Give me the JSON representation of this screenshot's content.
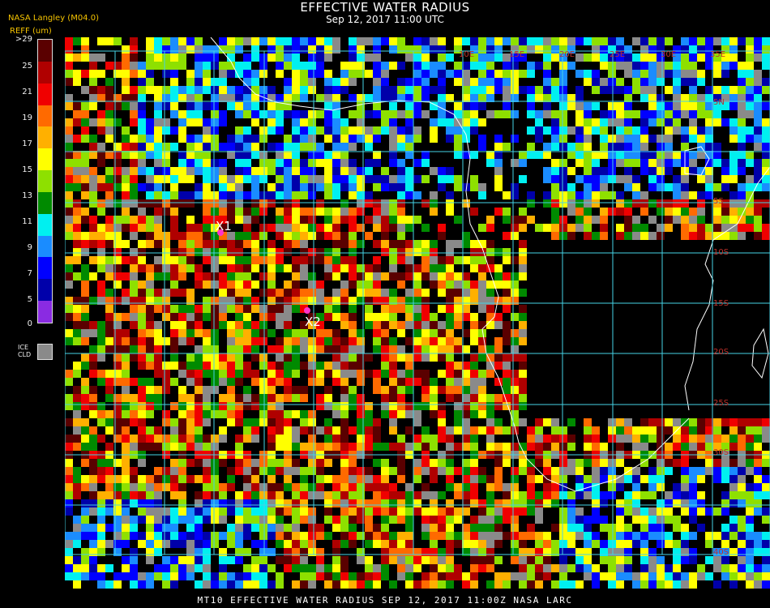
{
  "title": "EFFECTIVE WATER RADIUS",
  "subtitle": "Sep 12, 2017 11:00 UTC",
  "producer": "NASA Langley (M04.0)",
  "units_label": "REFF (um)",
  "colorbar": {
    "labels": [
      ">29",
      "25",
      "21",
      "19",
      "17",
      "15",
      "13",
      "11",
      "9",
      "7",
      "5",
      "0"
    ],
    "colors": [
      "#5a0000",
      "#b00000",
      "#f00000",
      "#ff6a00",
      "#ffb000",
      "#ffff00",
      "#8ee000",
      "#008a00",
      "#00f0f0",
      "#1a8cff",
      "#0000ff",
      "#0000aa",
      "#8a2be2"
    ]
  },
  "ice_cloud_label_line1": "ICE",
  "ice_cloud_label_line2": "CLD",
  "ice_cloud_color": "#8a8a8a",
  "markers": [
    {
      "label": "X1",
      "color": "#ff33cc"
    },
    {
      "label": "X2",
      "color": "#ff33cc"
    }
  ],
  "lat_labels": [
    "5N",
    "5S",
    "10S",
    "15S",
    "20S",
    "25S",
    "30S",
    "40S"
  ],
  "lon_labels": [
    "10E",
    "15E",
    "20E",
    "25E",
    "30E",
    "35E"
  ],
  "grid_color": "#46d3e6",
  "coast_color": "#ffffff",
  "footer": "MT10  EFFECTIVE WATER RADIUS  SEP 12, 2017 11:00Z  NASA LARC"
}
